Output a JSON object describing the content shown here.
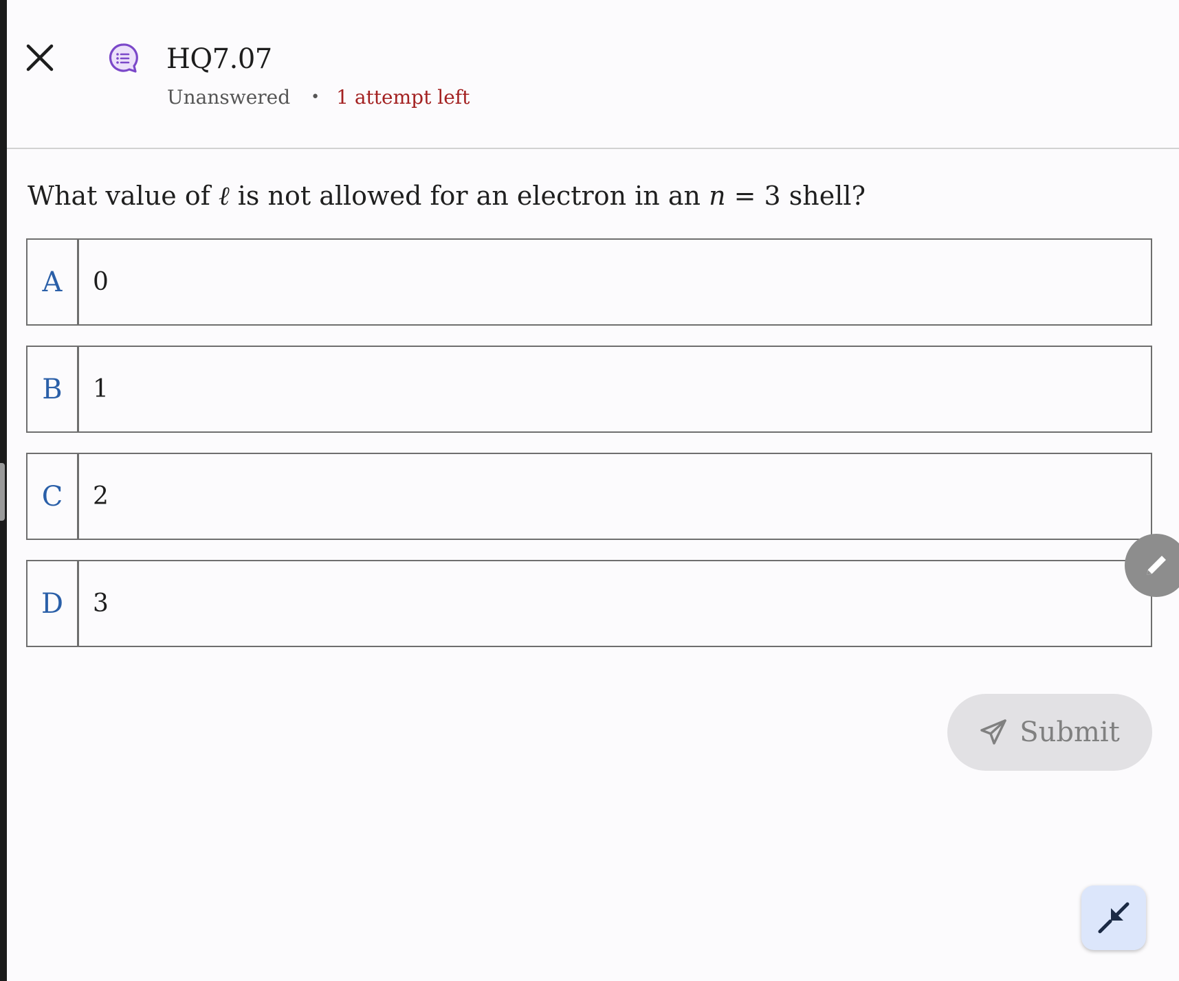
{
  "header": {
    "title": "HQ7.07",
    "status": "Unanswered",
    "separator": "•",
    "attempts": "1 attempt left",
    "close_icon": "close-icon",
    "quiz_icon": "quiz-chat-icon"
  },
  "question": {
    "prefix": "What value of ",
    "symbol_l": "ℓ",
    "middle": " is not allowed for an electron in an ",
    "symbol_n": "n",
    "suffix": " = 3 shell?"
  },
  "options": [
    {
      "letter": "A",
      "text": "0"
    },
    {
      "letter": "B",
      "text": "1"
    },
    {
      "letter": "C",
      "text": "2"
    },
    {
      "letter": "D",
      "text": "3"
    }
  ],
  "submit": {
    "label": "Submit",
    "icon": "send-icon"
  },
  "floating": {
    "pencil_icon": "pencil-icon",
    "collapse_icon": "collapse-icon"
  },
  "colors": {
    "accent_letter": "#2a5fa8",
    "attempts": "#a32121",
    "quiz_icon": "#7b48c9",
    "collapse_bg": "#dce6fb"
  }
}
